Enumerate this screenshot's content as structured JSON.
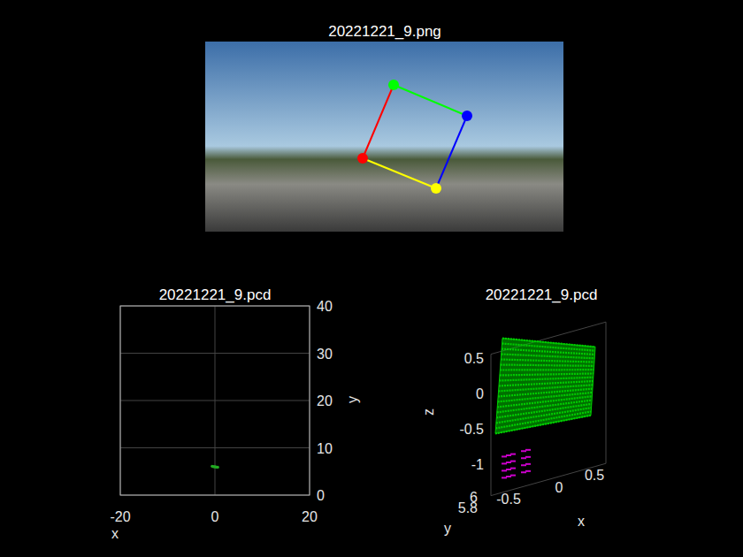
{
  "image_panel": {
    "title": "20221221_9.png",
    "corners": [
      {
        "color": "#ff0000"
      },
      {
        "color": "#00ff00"
      },
      {
        "color": "#0000ff"
      },
      {
        "color": "#ffff00"
      }
    ]
  },
  "top_view": {
    "title": "20221221_9.pcd",
    "x_ticks": [
      "-20",
      "0",
      "20"
    ],
    "y_ticks": [
      "0",
      "10",
      "20",
      "30",
      "40"
    ],
    "x_label": "x",
    "y_label": "y",
    "point_color": "#22aa22",
    "points": [
      [
        -0.6,
        6.1
      ],
      [
        -0.4,
        6.05
      ],
      [
        -0.2,
        6.0
      ],
      [
        0,
        6.0
      ],
      [
        0.2,
        5.95
      ],
      [
        0.4,
        5.9
      ],
      [
        0.6,
        5.9
      ]
    ]
  },
  "view_3d": {
    "title": "20221221_9.pcd",
    "z_ticks": [
      "0.5",
      "0",
      "-0.5",
      "-1"
    ],
    "x_ticks": [
      "-0.5",
      "0",
      "0.5"
    ],
    "y_ticks": [
      "6",
      "5.8"
    ],
    "x_label": "x",
    "y_label": "y",
    "z_label": "z",
    "board": {
      "color": "#00cc00",
      "corners": [
        [
          -0.57,
          6,
          0.73
        ],
        [
          0.48,
          6,
          0.24
        ],
        [
          0.43,
          6,
          -0.71
        ],
        [
          -0.65,
          6,
          -0.59
        ]
      ]
    },
    "legs": {
      "color": "#cc00cc",
      "points": [
        [
          -0.55,
          6,
          -0.95
        ],
        [
          -0.5,
          6,
          -0.95
        ],
        [
          -0.45,
          6,
          -0.95
        ],
        [
          -0.33,
          6,
          -0.95
        ],
        [
          -0.28,
          6,
          -0.95
        ],
        [
          -0.55,
          6,
          -1.05
        ],
        [
          -0.5,
          6,
          -1.05
        ],
        [
          -0.45,
          6,
          -1.05
        ],
        [
          -0.33,
          6,
          -1.05
        ],
        [
          -0.28,
          6,
          -1.05
        ],
        [
          -0.55,
          6,
          -1.15
        ],
        [
          -0.5,
          6,
          -1.15
        ],
        [
          -0.45,
          6,
          -1.15
        ],
        [
          -0.33,
          6,
          -1.15
        ],
        [
          -0.28,
          6,
          -1.15
        ],
        [
          -0.55,
          6,
          -1.25
        ],
        [
          -0.5,
          6,
          -1.25
        ],
        [
          -0.45,
          6,
          -1.25
        ],
        [
          -0.33,
          6,
          -1.25
        ],
        [
          -0.28,
          6,
          -1.25
        ]
      ]
    }
  }
}
